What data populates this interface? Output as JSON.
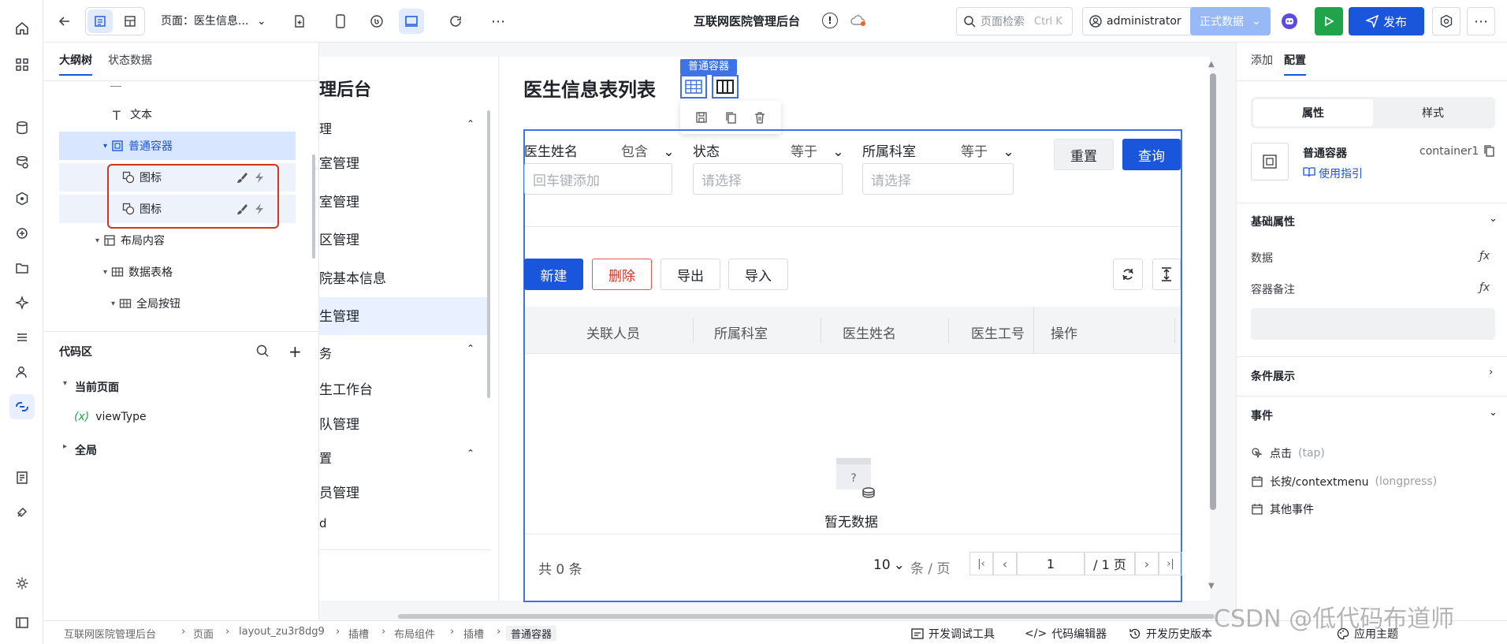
{
  "header": {
    "page_label": "页面：医生信息...",
    "app_title": "互联网医院管理后台",
    "search_placeholder": "页面检索",
    "search_shortcut": "Ctrl K",
    "user": "administrator",
    "data_mode": "正式数据",
    "publish": "发布"
  },
  "outline": {
    "tabs": [
      "大纲树",
      "状态数据"
    ],
    "tree": [
      {
        "label": "文本",
        "icon": "text-icon"
      },
      {
        "label": "普通容器",
        "icon": "container-icon",
        "selected": true
      },
      {
        "label": "图标",
        "icon": "icon-shapes-icon"
      },
      {
        "label": "图标",
        "icon": "icon-shapes-icon"
      },
      {
        "label": "布局内容",
        "icon": "layout-icon"
      },
      {
        "label": "数据表格",
        "icon": "table-icon"
      },
      {
        "label": "全局按钮",
        "icon": "table-icon"
      }
    ],
    "code_area": "代码区",
    "current_page": "当前页面",
    "variable": "viewType",
    "global": "全局"
  },
  "preview": {
    "nav_title": "理后台",
    "nav": [
      "理",
      "室管理",
      "室管理",
      "区管理",
      "院基本信息",
      "生管理",
      "务",
      "生工作台",
      "队管理",
      "置",
      "员管理",
      "d"
    ],
    "page_title": "医生信息表列表",
    "container_chip": "普通容器",
    "filters": [
      {
        "label": "医生姓名",
        "op": "包含",
        "placeholder": "回车键添加"
      },
      {
        "label": "状态",
        "op": "等于",
        "placeholder": "请选择"
      },
      {
        "label": "所属科室",
        "op": "等于",
        "placeholder": "请选择"
      }
    ],
    "reset": "重置",
    "query": "查询",
    "actions": [
      "新建",
      "删除",
      "导出",
      "导入"
    ],
    "columns": [
      "关联人员",
      "所属科室",
      "医生姓名",
      "医生工号",
      "操作"
    ],
    "empty": "暂无数据",
    "total": "共 0 条",
    "page_size": "10",
    "per_page": "条 / 页",
    "page": "1",
    "pages": "/ 1 页"
  },
  "rpanel": {
    "tabs": [
      "添加",
      "配置"
    ],
    "seg": [
      "属性",
      "样式"
    ],
    "comp_name": "普通容器",
    "comp_id": "container1",
    "guide": "使用指引",
    "basic": "基础属性",
    "data": "数据",
    "note": "容器备注",
    "cond": "条件展示",
    "events": "事件",
    "evt_tap": "点击",
    "evt_tap_code": "(tap)",
    "evt_long": "长按/contextmenu",
    "evt_long_code": "(longpress)",
    "evt_other": "其他事件"
  },
  "footer": {
    "crumbs": [
      "互联网医院管理后台",
      "页面",
      "layout_zu3r8dg9",
      "插槽",
      "布局组件",
      "插槽",
      "普通容器"
    ],
    "devtools": "开发调试工具",
    "code_editor": "代码编辑器",
    "history": "开发历史版本",
    "theme": "应用主题",
    "watermark": "CSDN @低代码布道师"
  },
  "colors": {
    "accent": "#1a56db",
    "selection": "#3d73e6",
    "highlight": "#d4331e",
    "run": "#20a34b"
  }
}
